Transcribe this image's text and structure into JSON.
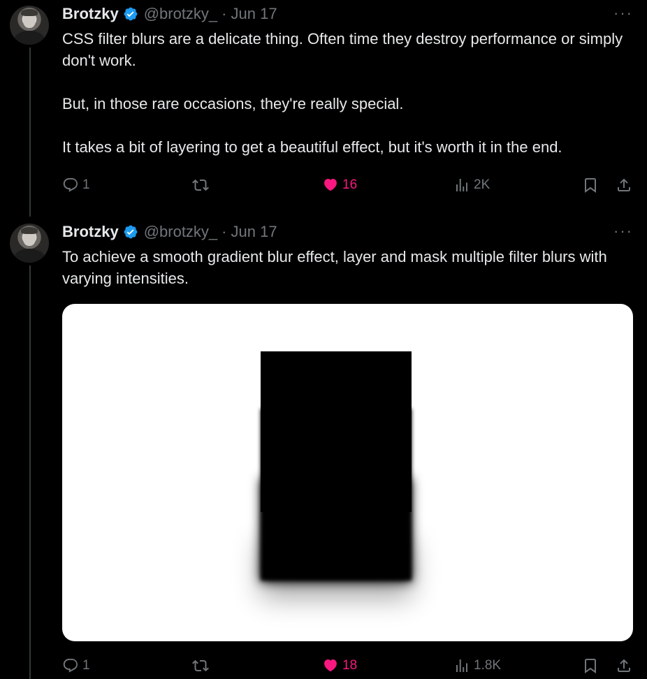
{
  "tweets": [
    {
      "author": "Brotzky",
      "handle": "@brotzky_",
      "separator": "·",
      "date": "Jun 17",
      "more": "···",
      "paragraphs": [
        "CSS filter blurs are a delicate thing. Often time they destroy performance or simply don't work.",
        "But, in those rare occasions, they're really special.",
        "It takes a bit of layering to get a beautiful effect, but it's worth it in the end."
      ],
      "stats": {
        "replies": "1",
        "retweets": "",
        "likes": "16",
        "views": "2K"
      }
    },
    {
      "author": "Brotzky",
      "handle": "@brotzky_",
      "separator": "·",
      "date": "Jun 17",
      "more": "···",
      "paragraphs": [
        "To achieve a smooth gradient blur effect, layer and mask multiple filter blurs with varying intensities."
      ],
      "stats": {
        "replies": "1",
        "retweets": "",
        "likes": "18",
        "views": "1.8K"
      }
    }
  ],
  "colors": {
    "background": "#000000",
    "text": "#e7e9ea",
    "muted": "#71767b",
    "like": "#f91880",
    "verified": "#1d9bf0"
  },
  "icons": {
    "verified": "verified-badge-icon",
    "reply": "reply-icon",
    "retweet": "retweet-icon",
    "like": "heart-icon",
    "views": "views-chart-icon",
    "bookmark": "bookmark-icon",
    "share": "share-icon",
    "more": "more-icon"
  }
}
